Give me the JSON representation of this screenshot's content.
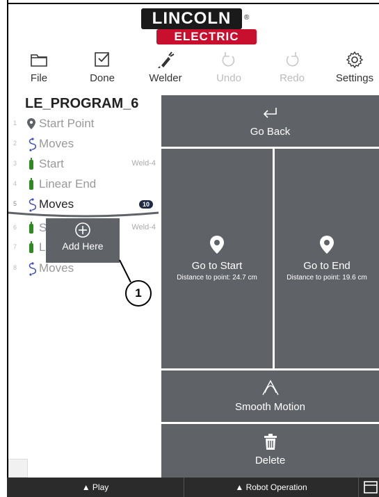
{
  "logo": {
    "top": "LINCOLN",
    "bottom": "ELECTRIC",
    "reg": "®"
  },
  "toolbar": {
    "file": "File",
    "done": "Done",
    "welder": "Welder",
    "undo": "Undo",
    "redo": "Redo",
    "settings": "Settings"
  },
  "program": {
    "title": "LE_PROGRAM_6",
    "steps": [
      {
        "num": "1",
        "label": "Start Point",
        "tag": ""
      },
      {
        "num": "2",
        "label": "Moves",
        "tag": ""
      },
      {
        "num": "3",
        "label": "Start",
        "tag": "Weld-4"
      },
      {
        "num": "4",
        "label": "Linear End",
        "tag": ""
      },
      {
        "num": "5",
        "label": "Moves",
        "badge": "10"
      },
      {
        "num": "6",
        "label": "S",
        "tag": "Weld-4"
      },
      {
        "num": "7",
        "label": "L",
        "tag": ""
      },
      {
        "num": "8",
        "label": "Moves",
        "tag": ""
      }
    ],
    "add_here": "Add Here",
    "callout": "1"
  },
  "actions": {
    "go_back": "Go Back",
    "go_to_start": "Go to Start",
    "go_to_start_dist": "Distance to point: 24.7 cm",
    "go_to_end": "Go to End",
    "go_to_end_dist": "Distance to point: 19.6 cm",
    "smooth_motion": "Smooth Motion",
    "delete": "Delete"
  },
  "bottombar": {
    "play": "▲ Play",
    "robot_operation": "▲ Robot Operation"
  },
  "colors": {
    "button_gray": "#5f6368",
    "brand_red": "#c8102e",
    "weld_green": "#2e8b1f",
    "move_blue": "#3f51b5"
  }
}
